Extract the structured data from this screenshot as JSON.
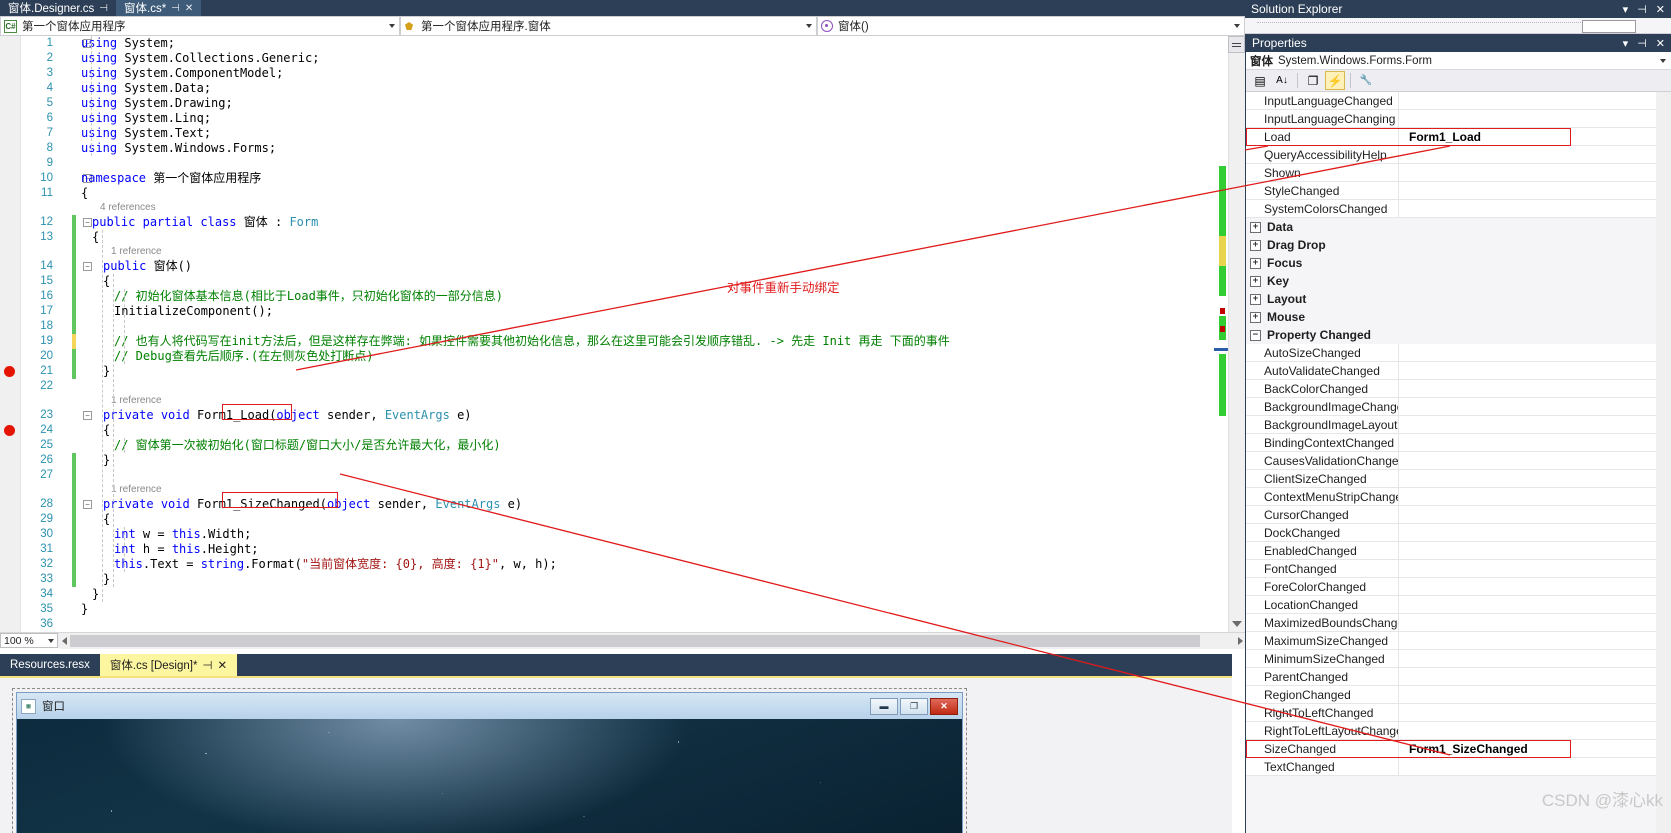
{
  "editor_tabs": [
    {
      "label": "窗体.Designer.cs",
      "active": false,
      "pin": "⊣",
      "close": ""
    },
    {
      "label": "窗体.cs*",
      "active": true,
      "pin": "⊣",
      "close": "✕"
    }
  ],
  "project_bar": {
    "icon": "csharp-icon",
    "label": "第一个窗体应用程序"
  },
  "nav_bar": {
    "type_label": "第一个窗体应用程序.窗体",
    "member_label": "窗体()"
  },
  "code": {
    "zoom_level": "100 %",
    "lines": [
      {
        "n": 1,
        "ref": null,
        "fold": "−",
        "indent": 0,
        "tokens": [
          {
            "t": "using",
            "c": "kw"
          },
          {
            "t": " System;",
            "c": "pln"
          }
        ]
      },
      {
        "n": 2,
        "ref": null,
        "fold": null,
        "indent": 0,
        "tokens": [
          {
            "t": "using",
            "c": "kw"
          },
          {
            "t": " System.Collections.Generic;",
            "c": "pln"
          }
        ]
      },
      {
        "n": 3,
        "ref": null,
        "fold": null,
        "indent": 0,
        "tokens": [
          {
            "t": "using",
            "c": "kw"
          },
          {
            "t": " System.ComponentModel;",
            "c": "pln"
          }
        ]
      },
      {
        "n": 4,
        "ref": null,
        "fold": null,
        "indent": 0,
        "tokens": [
          {
            "t": "using",
            "c": "kw"
          },
          {
            "t": " System.Data;",
            "c": "pln"
          }
        ]
      },
      {
        "n": 5,
        "ref": null,
        "fold": null,
        "indent": 0,
        "tokens": [
          {
            "t": "using",
            "c": "kw"
          },
          {
            "t": " System.Drawing;",
            "c": "pln"
          }
        ]
      },
      {
        "n": 6,
        "ref": null,
        "fold": null,
        "indent": 0,
        "tokens": [
          {
            "t": "using",
            "c": "kw"
          },
          {
            "t": " System.Linq;",
            "c": "pln"
          }
        ]
      },
      {
        "n": 7,
        "ref": null,
        "fold": null,
        "indent": 0,
        "tokens": [
          {
            "t": "using",
            "c": "kw"
          },
          {
            "t": " System.Text;",
            "c": "pln"
          }
        ]
      },
      {
        "n": 8,
        "ref": null,
        "fold": null,
        "indent": 0,
        "tokens": [
          {
            "t": "using",
            "c": "kw"
          },
          {
            "t": " System.Windows.Forms;",
            "c": "pln"
          }
        ]
      },
      {
        "n": 9,
        "ref": null,
        "fold": null,
        "indent": 0,
        "tokens": []
      },
      {
        "n": 10,
        "ref": null,
        "fold": "−",
        "indent": 0,
        "tokens": [
          {
            "t": "namespace",
            "c": "kw"
          },
          {
            "t": " 第一个窗体应用程序",
            "c": "ns"
          }
        ]
      },
      {
        "n": 11,
        "ref": null,
        "fold": null,
        "indent": 0,
        "tokens": [
          {
            "t": "{",
            "c": "pln"
          }
        ]
      },
      {
        "n": 12,
        "ref": "4 references",
        "fold": "−",
        "indent": 1,
        "tokens": [
          {
            "t": "public",
            "c": "kw"
          },
          {
            "t": " ",
            "c": "pln"
          },
          {
            "t": "partial",
            "c": "kw"
          },
          {
            "t": " ",
            "c": "pln"
          },
          {
            "t": "class",
            "c": "kw"
          },
          {
            "t": " 窗体 : ",
            "c": "pln"
          },
          {
            "t": "Form",
            "c": "typ"
          }
        ]
      },
      {
        "n": 13,
        "ref": null,
        "fold": null,
        "indent": 1,
        "tokens": [
          {
            "t": "{",
            "c": "pln"
          }
        ]
      },
      {
        "n": 14,
        "ref": "1 reference",
        "fold": "−",
        "indent": 2,
        "tokens": [
          {
            "t": "public",
            "c": "kw"
          },
          {
            "t": " 窗体()",
            "c": "pln"
          }
        ]
      },
      {
        "n": 15,
        "ref": null,
        "fold": null,
        "indent": 2,
        "tokens": [
          {
            "t": "{",
            "c": "pln"
          }
        ]
      },
      {
        "n": 16,
        "ref": null,
        "fold": null,
        "indent": 3,
        "tokens": [
          {
            "t": "// 初始化窗体基本信息(相比于Load事件，只初始化窗体的一部分信息)",
            "c": "cmt"
          }
        ]
      },
      {
        "n": 17,
        "ref": null,
        "fold": null,
        "indent": 3,
        "tokens": [
          {
            "t": "InitializeComponent();",
            "c": "pln"
          }
        ]
      },
      {
        "n": 18,
        "ref": null,
        "fold": null,
        "indent": 3,
        "tokens": []
      },
      {
        "n": 19,
        "ref": null,
        "fold": null,
        "indent": 3,
        "tokens": [
          {
            "t": "// 也有人将代码写在init方法后，但是这样存在弊端: 如果控件需要其他初始化信息，那么在这里可能会引发顺序错乱. -> 先走 Init 再走 下面的事件",
            "c": "cmt"
          }
        ]
      },
      {
        "n": 20,
        "ref": null,
        "fold": null,
        "indent": 3,
        "tokens": [
          {
            "t": "// Debug查看先后顺序.(在左侧灰色处打断点)",
            "c": "cmt"
          }
        ]
      },
      {
        "n": 21,
        "ref": null,
        "fold": null,
        "indent": 2,
        "tokens": [
          {
            "t": "}",
            "c": "pln"
          }
        ]
      },
      {
        "n": 22,
        "ref": null,
        "fold": null,
        "indent": 2,
        "tokens": []
      },
      {
        "n": 23,
        "ref": "1 reference",
        "fold": "−",
        "indent": 2,
        "tokens": [
          {
            "t": "private",
            "c": "kw"
          },
          {
            "t": " ",
            "c": "pln"
          },
          {
            "t": "void",
            "c": "kw"
          },
          {
            "t": " Form1_Load(",
            "c": "pln"
          },
          {
            "t": "object",
            "c": "kw"
          },
          {
            "t": " sender, ",
            "c": "pln"
          },
          {
            "t": "EventArgs",
            "c": "typ"
          },
          {
            "t": " e)",
            "c": "pln"
          }
        ]
      },
      {
        "n": 24,
        "ref": null,
        "fold": null,
        "indent": 2,
        "tokens": [
          {
            "t": "{",
            "c": "pln"
          }
        ]
      },
      {
        "n": 25,
        "ref": null,
        "fold": null,
        "indent": 3,
        "tokens": [
          {
            "t": "// 窗体第一次被初始化(窗口标题/窗口大小/是否允许最大化，最小化)",
            "c": "cmt"
          }
        ]
      },
      {
        "n": 26,
        "ref": null,
        "fold": null,
        "indent": 2,
        "tokens": [
          {
            "t": "}",
            "c": "pln"
          }
        ]
      },
      {
        "n": 27,
        "ref": null,
        "fold": null,
        "indent": 2,
        "tokens": []
      },
      {
        "n": 28,
        "ref": "1 reference",
        "fold": "−",
        "indent": 2,
        "tokens": [
          {
            "t": "private",
            "c": "kw"
          },
          {
            "t": " ",
            "c": "pln"
          },
          {
            "t": "void",
            "c": "kw"
          },
          {
            "t": " Form1_SizeChanged(",
            "c": "pln"
          },
          {
            "t": "object",
            "c": "kw"
          },
          {
            "t": " sender, ",
            "c": "pln"
          },
          {
            "t": "EventArgs",
            "c": "typ"
          },
          {
            "t": " e)",
            "c": "pln"
          }
        ]
      },
      {
        "n": 29,
        "ref": null,
        "fold": null,
        "indent": 2,
        "tokens": [
          {
            "t": "{",
            "c": "pln"
          }
        ]
      },
      {
        "n": 30,
        "ref": null,
        "fold": null,
        "indent": 3,
        "tokens": [
          {
            "t": "int",
            "c": "kw"
          },
          {
            "t": " w = ",
            "c": "pln"
          },
          {
            "t": "this",
            "c": "kw"
          },
          {
            "t": ".Width;",
            "c": "pln"
          }
        ]
      },
      {
        "n": 31,
        "ref": null,
        "fold": null,
        "indent": 3,
        "tokens": [
          {
            "t": "int",
            "c": "kw"
          },
          {
            "t": " h = ",
            "c": "pln"
          },
          {
            "t": "this",
            "c": "kw"
          },
          {
            "t": ".Height;",
            "c": "pln"
          }
        ]
      },
      {
        "n": 32,
        "ref": null,
        "fold": null,
        "indent": 3,
        "tokens": [
          {
            "t": "this",
            "c": "kw"
          },
          {
            "t": ".Text = ",
            "c": "pln"
          },
          {
            "t": "string",
            "c": "kw"
          },
          {
            "t": ".Format(",
            "c": "pln"
          },
          {
            "t": "\"当前窗体宽度: {0}, 高度: {1}\"",
            "c": "str"
          },
          {
            "t": ", w, h);",
            "c": "pln"
          }
        ]
      },
      {
        "n": 33,
        "ref": null,
        "fold": null,
        "indent": 2,
        "tokens": [
          {
            "t": "}",
            "c": "pln"
          }
        ]
      },
      {
        "n": 34,
        "ref": null,
        "fold": null,
        "indent": 1,
        "tokens": [
          {
            "t": "}",
            "c": "pln"
          }
        ]
      },
      {
        "n": 35,
        "ref": null,
        "fold": null,
        "indent": 0,
        "tokens": [
          {
            "t": "}",
            "c": "pln"
          }
        ]
      },
      {
        "n": 36,
        "ref": null,
        "fold": null,
        "indent": 0,
        "tokens": []
      }
    ],
    "annotation": "对事件重新手动绑定",
    "breakpoint_lines": [
      21,
      24
    ]
  },
  "bottom_tabs": [
    {
      "label": "Resources.resx",
      "active": false,
      "pin": "",
      "close": ""
    },
    {
      "label": "窗体.cs [Design]*",
      "active": true,
      "pin": "⊣",
      "close": "✕"
    }
  ],
  "designer": {
    "form_title": "窗口",
    "minimize_label": "▬",
    "maximize_label": "❐",
    "close_label": "✕"
  },
  "solution_explorer": {
    "title": "Solution Explorer",
    "dropdown_icon": "chevron-down-icon",
    "pin_icon": "pin-icon",
    "close_icon": "close-icon"
  },
  "properties": {
    "title": "Properties",
    "object_name": "窗体",
    "object_type": "System.Windows.Forms.Form",
    "toolbar": [
      {
        "name": "categorized-view-button",
        "glyph": "▤",
        "selected": false
      },
      {
        "name": "alphabetical-view-button",
        "glyph": "A↓",
        "selected": false
      },
      {
        "name": "properties-button",
        "glyph": "❐",
        "selected": false
      },
      {
        "name": "events-button",
        "glyph": "⚡",
        "selected": true
      },
      {
        "name": "property-pages-button",
        "glyph": "🔧",
        "selected": false
      }
    ],
    "rows": [
      {
        "kind": "prop",
        "name": "InputLanguageChanged",
        "value": ""
      },
      {
        "kind": "prop",
        "name": "InputLanguageChanging",
        "value": ""
      },
      {
        "kind": "prop",
        "name": "Load",
        "value": "Form1_Load",
        "highlight": true
      },
      {
        "kind": "prop",
        "name": "QueryAccessibilityHelp",
        "value": ""
      },
      {
        "kind": "prop",
        "name": "Shown",
        "value": ""
      },
      {
        "kind": "prop",
        "name": "StyleChanged",
        "value": ""
      },
      {
        "kind": "prop",
        "name": "SystemColorsChanged",
        "value": ""
      },
      {
        "kind": "cat",
        "name": "Data",
        "expander": "+"
      },
      {
        "kind": "cat",
        "name": "Drag Drop",
        "expander": "+"
      },
      {
        "kind": "cat",
        "name": "Focus",
        "expander": "+"
      },
      {
        "kind": "cat",
        "name": "Key",
        "expander": "+"
      },
      {
        "kind": "cat",
        "name": "Layout",
        "expander": "+"
      },
      {
        "kind": "cat",
        "name": "Mouse",
        "expander": "+"
      },
      {
        "kind": "cat",
        "name": "Property Changed",
        "expander": "−"
      },
      {
        "kind": "prop",
        "name": "AutoSizeChanged",
        "value": ""
      },
      {
        "kind": "prop",
        "name": "AutoValidateChanged",
        "value": ""
      },
      {
        "kind": "prop",
        "name": "BackColorChanged",
        "value": ""
      },
      {
        "kind": "prop",
        "name": "BackgroundImageChanged",
        "value": ""
      },
      {
        "kind": "prop",
        "name": "BackgroundImageLayoutChanged",
        "value": ""
      },
      {
        "kind": "prop",
        "name": "BindingContextChanged",
        "value": ""
      },
      {
        "kind": "prop",
        "name": "CausesValidationChanged",
        "value": ""
      },
      {
        "kind": "prop",
        "name": "ClientSizeChanged",
        "value": ""
      },
      {
        "kind": "prop",
        "name": "ContextMenuStripChanged",
        "value": ""
      },
      {
        "kind": "prop",
        "name": "CursorChanged",
        "value": ""
      },
      {
        "kind": "prop",
        "name": "DockChanged",
        "value": ""
      },
      {
        "kind": "prop",
        "name": "EnabledChanged",
        "value": ""
      },
      {
        "kind": "prop",
        "name": "FontChanged",
        "value": ""
      },
      {
        "kind": "prop",
        "name": "ForeColorChanged",
        "value": ""
      },
      {
        "kind": "prop",
        "name": "LocationChanged",
        "value": ""
      },
      {
        "kind": "prop",
        "name": "MaximizedBoundsChanged",
        "value": ""
      },
      {
        "kind": "prop",
        "name": "MaximumSizeChanged",
        "value": ""
      },
      {
        "kind": "prop",
        "name": "MinimumSizeChanged",
        "value": ""
      },
      {
        "kind": "prop",
        "name": "ParentChanged",
        "value": ""
      },
      {
        "kind": "prop",
        "name": "RegionChanged",
        "value": ""
      },
      {
        "kind": "prop",
        "name": "RightToLeftChanged",
        "value": ""
      },
      {
        "kind": "prop",
        "name": "RightToLeftLayoutChanged",
        "value": ""
      },
      {
        "kind": "prop",
        "name": "SizeChanged",
        "value": "Form1_SizeChanged",
        "highlight": true
      },
      {
        "kind": "prop",
        "name": "TextChanged",
        "value": ""
      }
    ]
  },
  "watermark": "CSDN @漆心kk",
  "colors": {
    "chrome_dark": "#2d3f56",
    "tab_active": "#3e5c79",
    "annotation_red": "#e01b1b",
    "designer_tab": "#fdf6a0",
    "keyword_blue": "#0000ff",
    "comment_green": "#008000",
    "string_red": "#a31515",
    "type_teal": "#2b91af"
  }
}
